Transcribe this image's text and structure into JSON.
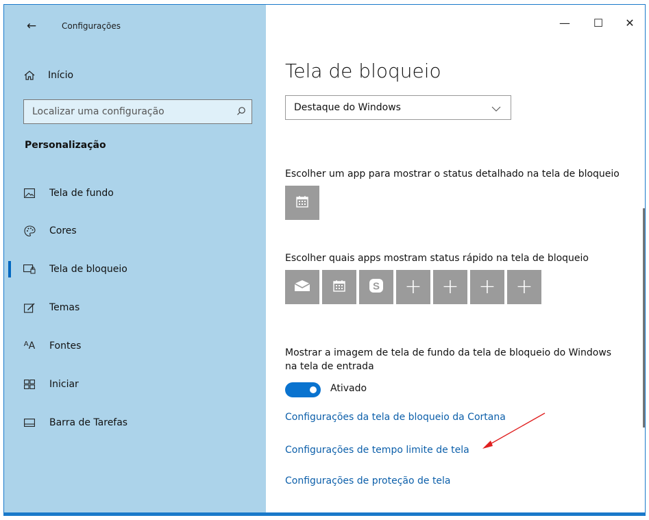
{
  "window": {
    "title": "Configurações",
    "controls": {
      "minimize": "—",
      "maximize": "☐",
      "close": "✕"
    }
  },
  "sidebar": {
    "home_label": "Início",
    "search_placeholder": "Localizar uma configuração",
    "section_title": "Personalização",
    "items": [
      {
        "label": "Tela de fundo",
        "icon": "picture-icon"
      },
      {
        "label": "Cores",
        "icon": "palette-icon"
      },
      {
        "label": "Tela de bloqueio",
        "icon": "lock-screen-icon",
        "active": true
      },
      {
        "label": "Temas",
        "icon": "brush-icon"
      },
      {
        "label": "Fontes",
        "icon": "font-icon"
      },
      {
        "label": "Iniciar",
        "icon": "start-icon"
      },
      {
        "label": "Barra de Tarefas",
        "icon": "taskbar-icon"
      }
    ]
  },
  "main": {
    "page_title": "Tela de bloqueio",
    "background_dropdown": {
      "selected": "Destaque do Windows"
    },
    "detailed_status_label": "Escolher um app para mostrar o status detalhado na tela de bloqueio",
    "detailed_status_app": "calendar-icon",
    "quick_status_label": "Escolher quais apps mostram status rápido na tela de bloqueio",
    "quick_status_apps": [
      "mail-icon",
      "calendar-icon",
      "skype-icon",
      "+",
      "+",
      "+",
      "+"
    ],
    "show_background_label_line1": "Mostrar a imagem de tela de fundo da tela de bloqueio do Windows",
    "show_background_label_line2": "na tela de entrada",
    "toggle_state": "Ativado",
    "toggle_on": true,
    "links": [
      "Configurações da tela de bloqueio da Cortana",
      "Configurações de tempo limite de tela",
      "Configurações de proteção de tela"
    ]
  },
  "colors": {
    "sidebar_bg": "#acd3ea",
    "accent": "#0a73cf",
    "link": "#0c5faa",
    "annotation_arrow": "#e02020"
  }
}
